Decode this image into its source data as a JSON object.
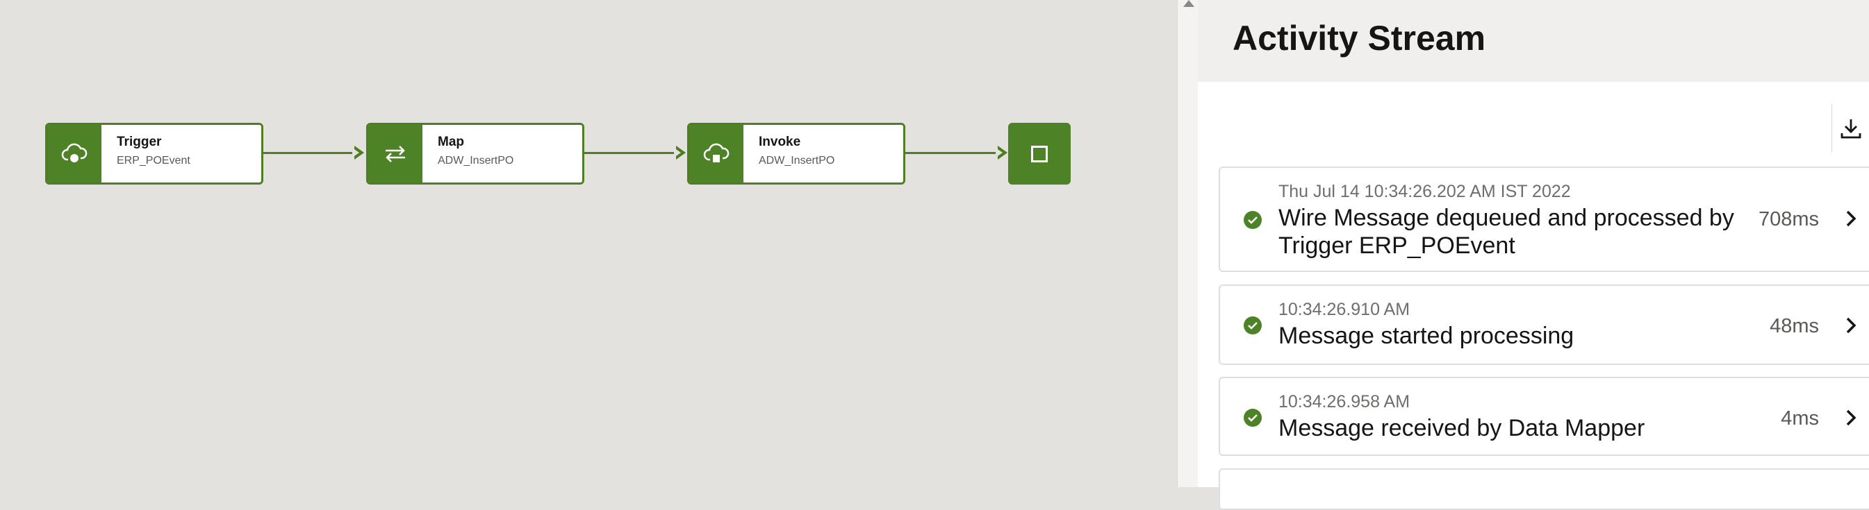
{
  "flow": {
    "nodes": [
      {
        "title": "Trigger",
        "subtitle": "ERP_POEvent",
        "icon": "cloud-trigger-icon"
      },
      {
        "title": "Map",
        "subtitle": "ADW_InsertPO",
        "icon": "swap-arrows-icon"
      },
      {
        "title": "Invoke",
        "subtitle": "ADW_InsertPO",
        "icon": "cloud-invoke-icon"
      }
    ],
    "end_icon": "stop-square-icon",
    "accent": "#4e8226"
  },
  "activity_stream": {
    "title": "Activity Stream",
    "download_icon": "download-icon",
    "entries": [
      {
        "timestamp": "Thu Jul 14 10:34:26.202 AM IST 2022",
        "message_line1": "Wire Message dequeued and processed by",
        "message_line2": "Trigger ERP_POEvent",
        "duration": "708ms",
        "status": "success"
      },
      {
        "timestamp": "10:34:26.910 AM",
        "message_line1": "Message started processing",
        "duration": "48ms",
        "status": "success"
      },
      {
        "timestamp": "10:34:26.958 AM",
        "message_line1": "Message received by Data Mapper",
        "duration": "4ms",
        "status": "success"
      }
    ]
  }
}
